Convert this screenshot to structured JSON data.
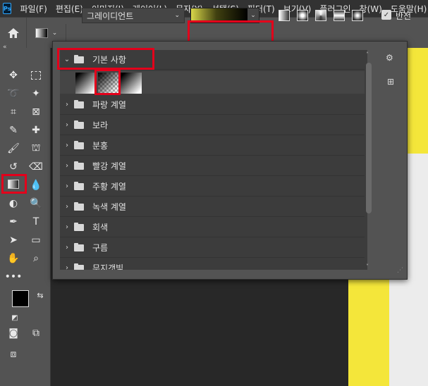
{
  "menubar": {
    "logo": "Ps",
    "items": [
      "파일(F)",
      "편집(E)",
      "이미지(I)",
      "레이어(L)",
      "문자(Y)",
      "선택(S)",
      "필터(T)",
      "보기(V)",
      "플러그인",
      "창(W)",
      "도움말(H)"
    ]
  },
  "options": {
    "preset_select": "그레이디언트",
    "reverse_label": "반전",
    "colors": {
      "gradient_start": "#d8d64a",
      "gradient_end": "#000000"
    }
  },
  "gradient_panel": {
    "open_group": "기본 사항",
    "groups": [
      "파랑 계열",
      "보라",
      "분홍",
      "빨강 계열",
      "주황 계열",
      "녹색 계열",
      "회색",
      "구름",
      "무지갯빛"
    ]
  },
  "colors": {
    "highlight": "#e3001b",
    "doc_yellow": "#f4e63a",
    "doc_white": "#ececec"
  }
}
